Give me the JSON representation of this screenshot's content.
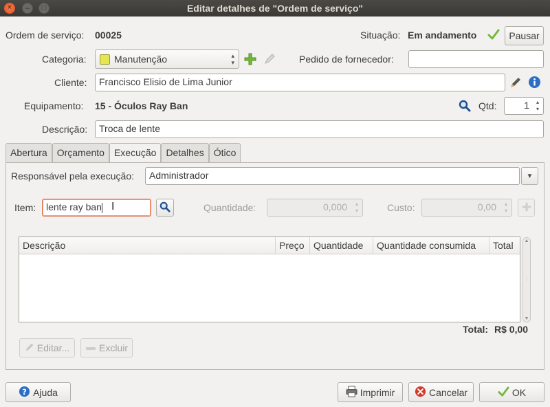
{
  "window": {
    "title": "Editar detalhes de \"Ordem de serviço\"",
    "close_glyph": "×",
    "minimize_glyph": "–",
    "maximize_glyph": "□"
  },
  "header": {
    "order_label": "Ordem de serviço:",
    "order_number": "00025",
    "status_label": "Situação:",
    "status_value": "Em andamento",
    "pause_button": "Pausar",
    "category_label": "Categoria:",
    "category_value": "Manutenção",
    "category_color": "#e6e652",
    "supplier_order_label": "Pedido de fornecedor:",
    "supplier_order_value": "",
    "client_label": "Cliente:",
    "client_value": "Francisco Elisio de Lima Junior",
    "equipment_label": "Equipamento:",
    "equipment_value": "15 - Óculos Ray Ban",
    "qty_label": "Qtd:",
    "qty_value": "1",
    "description_label": "Descrição:",
    "description_value": "Troca de lente"
  },
  "tabs": [
    {
      "label": "Abertura"
    },
    {
      "label": "Orçamento"
    },
    {
      "label": "Execução"
    },
    {
      "label": "Detalhes"
    },
    {
      "label": "Ótico"
    }
  ],
  "execution": {
    "responsible_label": "Responsável pela execução:",
    "responsible_value": "Administrador",
    "item_label": "Item:",
    "item_value": "lente ray ban",
    "quantity_label": "Quantidade:",
    "quantity_value": "0,000",
    "cost_label": "Custo:",
    "cost_value": "0,00",
    "columns": [
      "Descrição",
      "Preço",
      "Quantidade",
      "Quantidade consumida",
      "Total"
    ],
    "rows": [],
    "total_label": "Total:",
    "total_value": "R$ 0,00",
    "edit_button": "Editar...",
    "delete_button": "Excluir"
  },
  "footer": {
    "help_button": "Ajuda",
    "print_button": "Imprimir",
    "cancel_button": "Cancelar",
    "ok_button": "OK"
  },
  "colors": {
    "accent_green": "#73b93c",
    "info_blue": "#2a6fc4",
    "cancel_red": "#d03a2a",
    "focus_orange": "#e07850"
  }
}
